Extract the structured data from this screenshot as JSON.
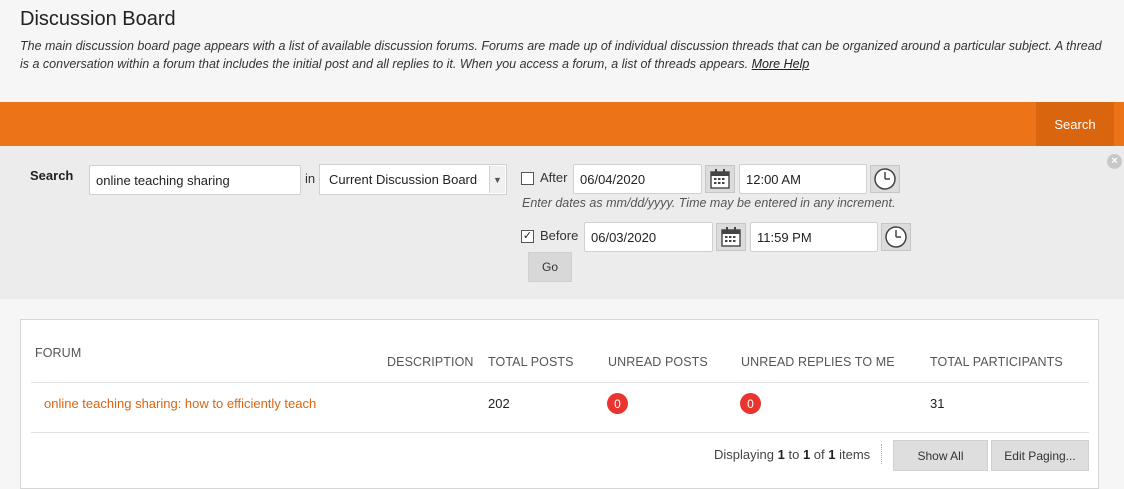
{
  "header": {
    "title": "Discussion Board",
    "description": "The main discussion board page appears with a list of available discussion forums. Forums are made up of individual discussion threads that can be organized around a particular subject. A thread is a conversation within a forum that includes the initial post and all replies to it. When you access a forum, a list of threads appears.",
    "more_help": "More Help"
  },
  "toolbar": {
    "search_button": "Search"
  },
  "search": {
    "label": "Search",
    "query": "online teaching sharing",
    "in_label": "in",
    "scope": "Current Discussion Board",
    "after": {
      "label": "After",
      "checked": false,
      "date": "06/04/2020",
      "time": "12:00 AM"
    },
    "hint": "Enter dates as mm/dd/yyyy. Time may be entered in any increment.",
    "before": {
      "label": "Before",
      "checked": true,
      "date": "06/03/2020",
      "time": "11:59 PM"
    },
    "go": "Go"
  },
  "table": {
    "columns": [
      "FORUM",
      "DESCRIPTION",
      "TOTAL POSTS",
      "UNREAD POSTS",
      "UNREAD REPLIES TO ME",
      "TOTAL PARTICIPANTS"
    ],
    "rows": [
      {
        "forum": "online teaching sharing: how to efficiently teach",
        "description": "",
        "total_posts": "202",
        "unread_posts": "0",
        "unread_replies": "0",
        "participants": "31"
      }
    ]
  },
  "paging": {
    "prefix": "Displaying",
    "from": "1",
    "to_word": "to",
    "to": "1",
    "of_word": "of",
    "total": "1",
    "suffix": "items",
    "show_all": "Show All",
    "edit_paging": "Edit Paging..."
  },
  "colors": {
    "accent": "#ec7317",
    "accent_dark": "#d9650f",
    "badge": "#e8352f"
  }
}
